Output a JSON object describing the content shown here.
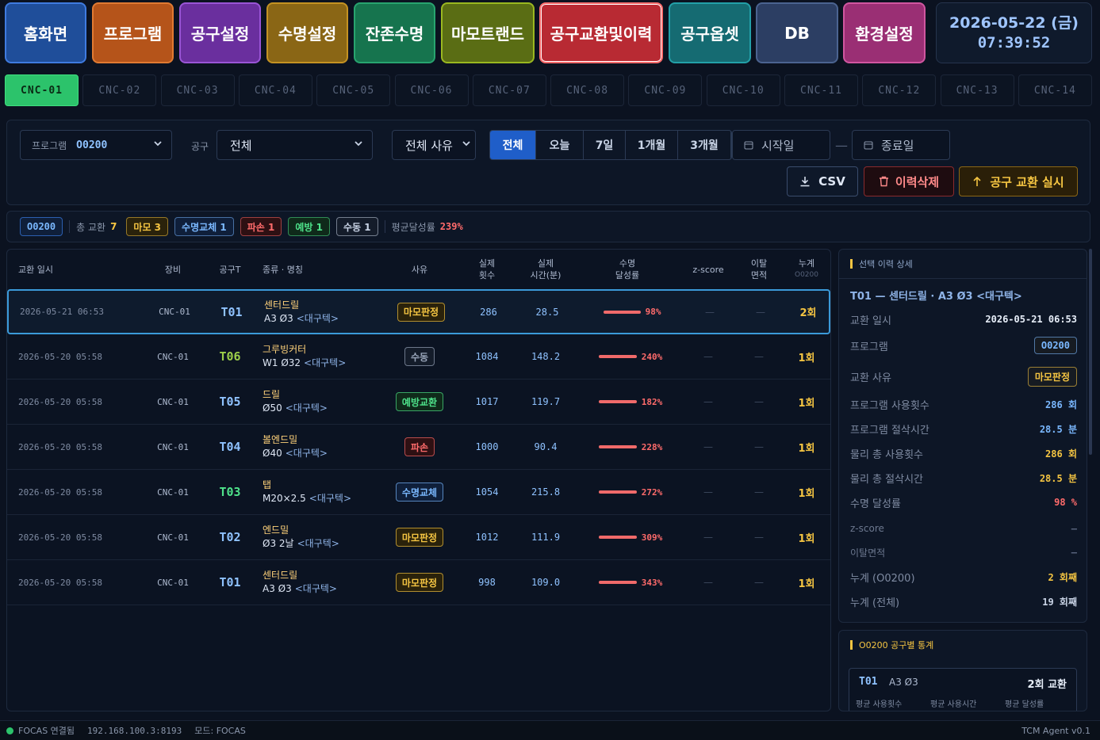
{
  "nav": {
    "items": [
      {
        "label": "홈화면",
        "bg": "#1f4e9a",
        "border": "#3f7be0"
      },
      {
        "label": "프로그램",
        "bg": "#b5541a",
        "border": "#e07a32"
      },
      {
        "label": "공구설정",
        "bg": "#6a2f9e",
        "border": "#9a55d6"
      },
      {
        "label": "수명설정",
        "bg": "#8a6615",
        "border": "#c49222"
      },
      {
        "label": "잔존수명",
        "bg": "#16744e",
        "border": "#28a46f"
      },
      {
        "label": "마모트랜드",
        "bg": "#5a6d14",
        "border": "#9ab820"
      },
      {
        "label": "공구교환및이력",
        "bg": "#b82a33",
        "border": "#ff6b6b"
      },
      {
        "label": "공구옵셋",
        "bg": "#156b72",
        "border": "#23a0a8"
      },
      {
        "label": "DB",
        "bg": "#2c3e63",
        "border": "#4b6390"
      },
      {
        "label": "환경설정",
        "bg": "#9a2f74",
        "border": "#d056a0"
      }
    ],
    "date": "2026-05-22 (금)",
    "time": "07:39:52"
  },
  "cnc_tabs": [
    "CNC-01",
    "CNC-02",
    "CNC-03",
    "CNC-04",
    "CNC-05",
    "CNC-06",
    "CNC-07",
    "CNC-08",
    "CNC-09",
    "CNC-10",
    "CNC-11",
    "CNC-12",
    "CNC-13",
    "CNC-14"
  ],
  "filter": {
    "program_label": "프로그램",
    "program_value": "O0200",
    "tool_label": "공구",
    "tool_value": "전체",
    "reason_value": "전체 사유",
    "periods": [
      "전체",
      "오늘",
      "7일",
      "1개월",
      "3개월"
    ],
    "start_date": "시작일",
    "end_date": "종료일",
    "dash": "—",
    "csv": "CSV",
    "delete": "이력삭제",
    "execute": "공구 교환 실시"
  },
  "summary": {
    "program": "O0200",
    "total_label": "총 교환",
    "total": "7",
    "chips": [
      {
        "label": "마모 3",
        "color": "#f5c542",
        "bg": "#2a220b"
      },
      {
        "label": "수명교체 1",
        "color": "#7ab8ff",
        "bg": "#0f1f3a"
      },
      {
        "label": "파손 1",
        "color": "#ff6b6b",
        "bg": "#2e1013"
      },
      {
        "label": "예방 1",
        "color": "#4ee28a",
        "bg": "#0f2a1a"
      },
      {
        "label": "수동 1",
        "color": "#c9d4e6",
        "bg": "#141c2a"
      }
    ],
    "avg_label": "평균달성률",
    "avg_value": "239%"
  },
  "table": {
    "headers": {
      "time": "교환 일시",
      "machine": "장비",
      "tool": "공구T",
      "type": "종류 · 명칭",
      "reason": "사유",
      "count1": "실제",
      "count2": "횟수",
      "mins1": "실제",
      "mins2": "시간(분)",
      "rate1": "수명",
      "rate2": "달성률",
      "z": "z-score",
      "dev1": "이탈",
      "dev2": "면적",
      "cum": "누계",
      "cum_sub": "O0200"
    },
    "rows": [
      {
        "time": "2026-05-21 06:53",
        "machine": "CNC-01",
        "tool": "T01",
        "tool_color": "#8fc2ff",
        "type": "센터드릴",
        "spec": "A3 Ø3",
        "maker": "<대구텍>",
        "reason": "마모판정",
        "reason_color": "#f5c542",
        "reason_bg": "#2a220b",
        "count": "286",
        "mins": "28.5",
        "rate": "98%",
        "rate_pct": 98,
        "z": "—",
        "dev": "—",
        "cum": "2회"
      },
      {
        "time": "2026-05-20 05:58",
        "machine": "CNC-01",
        "tool": "T06",
        "tool_color": "#9ccf4a",
        "type": "그루빙커터",
        "spec": "W1 Ø32",
        "maker": "<대구텍>",
        "reason": "수동",
        "reason_color": "#9aa6bb",
        "reason_bg": "#141c2a",
        "count": "1084",
        "mins": "148.2",
        "rate": "240%",
        "rate_pct": 240,
        "z": "—",
        "dev": "—",
        "cum": "1회"
      },
      {
        "time": "2026-05-20 05:58",
        "machine": "CNC-01",
        "tool": "T05",
        "tool_color": "#8fc2ff",
        "type": "드릴",
        "spec": "Ø50",
        "maker": "<대구텍>",
        "reason": "예방교환",
        "reason_color": "#4ee28a",
        "reason_bg": "#0f2a1a",
        "count": "1017",
        "mins": "119.7",
        "rate": "182%",
        "rate_pct": 182,
        "z": "—",
        "dev": "—",
        "cum": "1회"
      },
      {
        "time": "2026-05-20 05:58",
        "machine": "CNC-01",
        "tool": "T04",
        "tool_color": "#8fc2ff",
        "type": "볼엔드밀",
        "spec": "Ø40",
        "maker": "<대구텍>",
        "reason": "파손",
        "reason_color": "#ff6b6b",
        "reason_bg": "#2e1013",
        "count": "1000",
        "mins": "90.4",
        "rate": "228%",
        "rate_pct": 228,
        "z": "—",
        "dev": "—",
        "cum": "1회"
      },
      {
        "time": "2026-05-20 05:58",
        "machine": "CNC-01",
        "tool": "T03",
        "tool_color": "#4ee28a",
        "type": "탭",
        "spec": "M20×2.5",
        "maker": "<대구텍>",
        "reason": "수명교체",
        "reason_color": "#7ab8ff",
        "reason_bg": "#0f1f3a",
        "count": "1054",
        "mins": "215.8",
        "rate": "272%",
        "rate_pct": 272,
        "z": "—",
        "dev": "—",
        "cum": "1회"
      },
      {
        "time": "2026-05-20 05:58",
        "machine": "CNC-01",
        "tool": "T02",
        "tool_color": "#8fc2ff",
        "type": "엔드밀",
        "spec": "Ø3 2날",
        "maker": "<대구텍>",
        "reason": "마모판정",
        "reason_color": "#f5c542",
        "reason_bg": "#2a220b",
        "count": "1012",
        "mins": "111.9",
        "rate": "309%",
        "rate_pct": 309,
        "z": "—",
        "dev": "—",
        "cum": "1회"
      },
      {
        "time": "2026-05-20 05:58",
        "machine": "CNC-01",
        "tool": "T01",
        "tool_color": "#8fc2ff",
        "type": "센터드릴",
        "spec": "A3 Ø3",
        "maker": "<대구텍>",
        "reason": "마모판정",
        "reason_color": "#f5c542",
        "reason_bg": "#2a220b",
        "count": "998",
        "mins": "109.0",
        "rate": "343%",
        "rate_pct": 343,
        "z": "—",
        "dev": "—",
        "cum": "1회"
      }
    ]
  },
  "detail": {
    "title": "선택 이력 상세",
    "heading": "T01 — 센터드릴 · A3 Ø3 <대구텍>",
    "rows": [
      {
        "label": "교환 일시",
        "value": "2026-05-21  06:53",
        "color": "#e6edf8"
      },
      {
        "label": "프로그램",
        "value": "O0200",
        "color": "#7ab8ff",
        "chip": true
      },
      {
        "label": "교환 사유",
        "value": "마모판정",
        "color": "#f5c542",
        "chip": true
      },
      {
        "label": "프로그램 사용횟수",
        "value": "286 회",
        "color": "#7ab8ff"
      },
      {
        "label": "프로그램 절삭시간",
        "value": "28.5 분",
        "color": "#7ab8ff"
      },
      {
        "label": "물리 총 사용횟수",
        "value": "286 회",
        "color": "#f5c542"
      },
      {
        "label": "물리 총 절삭시간",
        "value": "28.5 분",
        "color": "#f5c542"
      },
      {
        "label": "수명 달성률",
        "value": "98 %",
        "color": "#ff6b6b"
      },
      {
        "label": "z-score",
        "value": "—",
        "color": "#56627a"
      },
      {
        "label": "이탈면적",
        "value": "—",
        "color": "#56627a"
      },
      {
        "label": "누계 (O0200)",
        "value": "2 회째",
        "color": "#f5c542"
      },
      {
        "label": "누계 (전체)",
        "value": "19 회째",
        "color": "#c9d4e6"
      }
    ]
  },
  "stats": {
    "title": "O0200 공구별 통계",
    "tool": "T01",
    "spec": "A3 Ø3",
    "count": "2회 교환",
    "cols": [
      "평균 사용횟수",
      "평균 사용시간",
      "평균 달성률"
    ]
  },
  "statusbar": {
    "conn": "FOCAS 연결됨",
    "ip": "192.168.100.3:8193",
    "mode": "모드: FOCAS",
    "version": "TCM Agent v0.1"
  }
}
